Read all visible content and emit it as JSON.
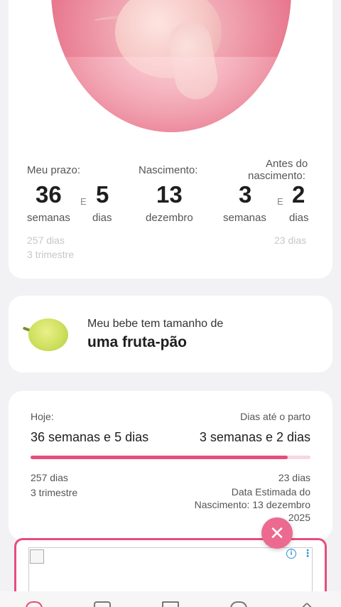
{
  "due": {
    "prazo_label": "Meu prazo:",
    "weeks": "36",
    "e1": "E",
    "days": "5",
    "weeks_unit": "semanas",
    "days_unit": "dias",
    "birth_label": "Nascimento:",
    "birth_day": "13",
    "birth_month": "dezembro",
    "before_label_1": "Antes do",
    "before_label_2": "nascimento:",
    "left_weeks": "3",
    "e2": "E",
    "left_days": "2",
    "left_weeks_unit": "semanas",
    "left_days_unit": "dias",
    "total_days": "257 dias",
    "trimester": "3 trimestre",
    "days_left_total": "23 dias"
  },
  "fruit": {
    "intro": "Meu bebe tem tamanho de",
    "name": "uma fruta-pão",
    "icon": "breadfruit-icon"
  },
  "progress": {
    "today_label": "Hoje:",
    "today_value": "36 semanas e 5 dias",
    "until_label": "Dias até o parto",
    "until_value": "3 semanas e 2 dias",
    "fraction": 0.918,
    "days": "257 dias",
    "trimester": "3 trimestre",
    "days_left": "23 dias",
    "estimate_1": "Data Estimada do",
    "estimate_2": "Nascimento: 13 dezembro",
    "estimate_3": "2025"
  },
  "ad": {
    "close_icon": "close-icon",
    "info_icon": "info-icon",
    "more_icon": "more-vert-icon"
  },
  "colors": {
    "accent": "#e64d7d",
    "fab": "#ec6a8f",
    "track": "#f7d7e0"
  }
}
